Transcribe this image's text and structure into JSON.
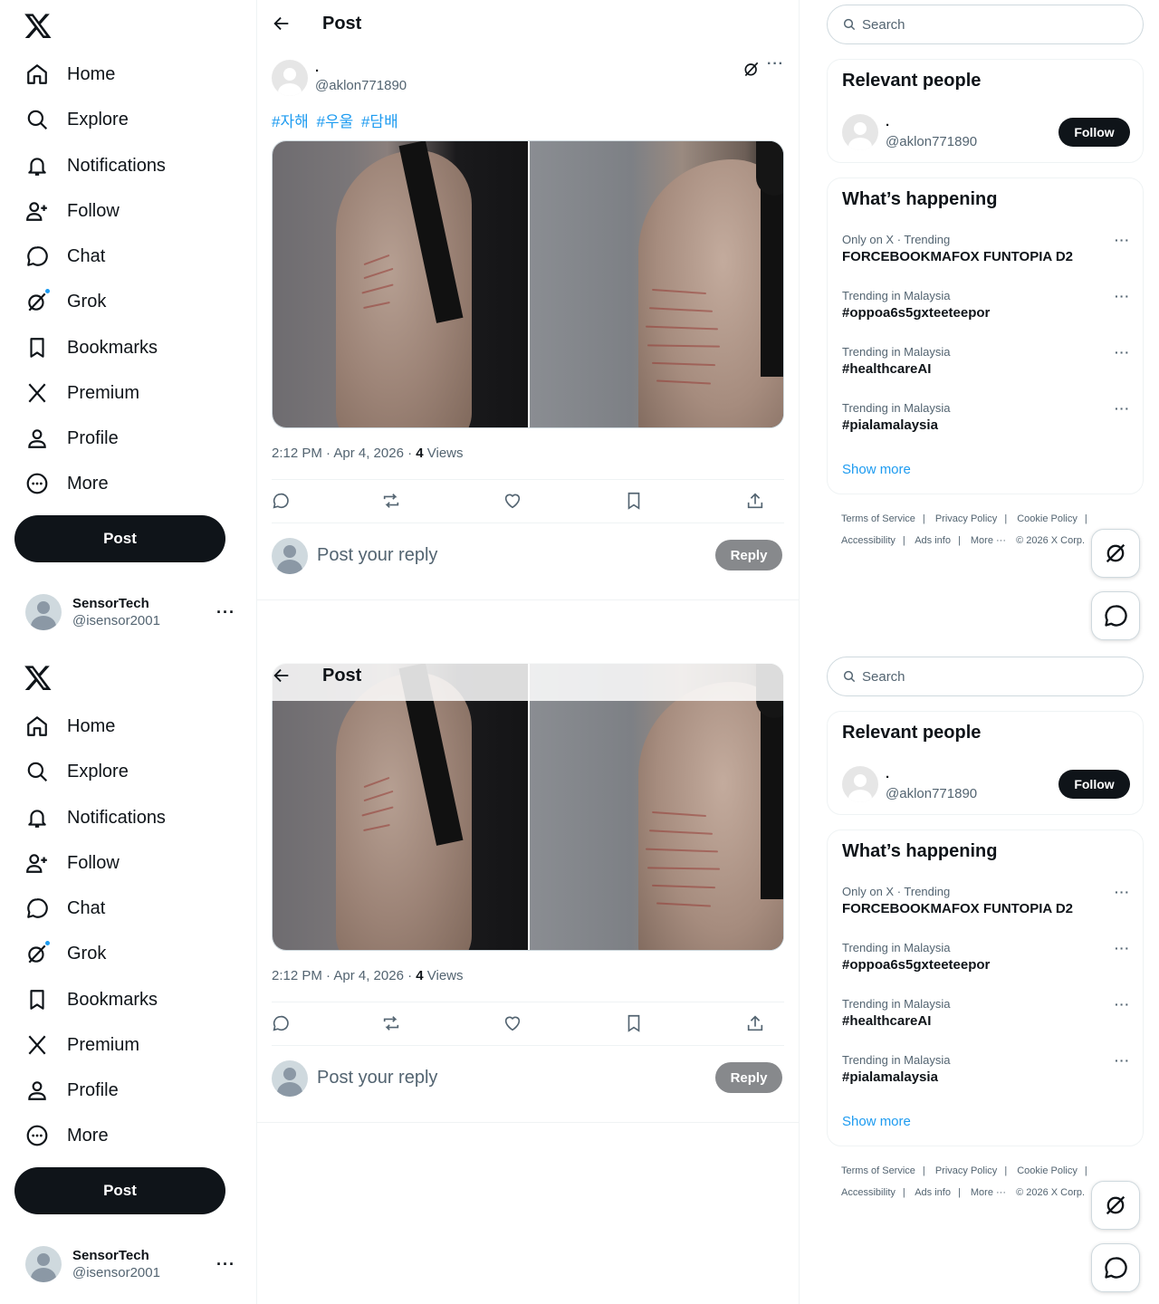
{
  "nav": {
    "items": [
      {
        "label": "Home",
        "icon": "home-icon"
      },
      {
        "label": "Explore",
        "icon": "search-icon"
      },
      {
        "label": "Notifications",
        "icon": "bell-icon"
      },
      {
        "label": "Follow",
        "icon": "person-add-icon"
      },
      {
        "label": "Chat",
        "icon": "chat-bubble-icon"
      },
      {
        "label": "Grok",
        "icon": "grok-icon"
      },
      {
        "label": "Bookmarks",
        "icon": "bookmark-icon"
      },
      {
        "label": "Premium",
        "icon": "x-logo-icon"
      },
      {
        "label": "Profile",
        "icon": "person-icon"
      },
      {
        "label": "More",
        "icon": "more-circle-icon"
      }
    ],
    "post_label": "Post"
  },
  "account": {
    "display_name": "SensorTech",
    "handle": "@isensor2001",
    "more": "···"
  },
  "header": {
    "title": "Post"
  },
  "tweet": {
    "author_name": ".",
    "author_handle": "@aklon771890",
    "more": "···",
    "hashtags": [
      "#자해",
      "#우울",
      "#담배"
    ],
    "time": "2:12 PM · Apr 4, 2026 · ",
    "views_count": "4",
    "views_label": " Views"
  },
  "reply": {
    "placeholder": "Post your reply",
    "button": "Reply"
  },
  "search": {
    "placeholder": "Search"
  },
  "relevant_people": {
    "title": "Relevant people",
    "name": ".",
    "handle": "@aklon771890",
    "follow": "Follow"
  },
  "happening": {
    "title": "What’s happening",
    "trends": [
      {
        "context": "Only on X · Trending",
        "topic": "FORCEBOOKMAFOX FUNTOPIA D2"
      },
      {
        "context": "Trending in Malaysia",
        "topic": "#oppoa6s5gxteeteepor"
      },
      {
        "context": "Trending in Malaysia",
        "topic": "#healthcareAI"
      },
      {
        "context": "Trending in Malaysia",
        "topic": "#pialamalaysia"
      }
    ],
    "trend_more": "···",
    "show_more": "Show more"
  },
  "footer": {
    "links": [
      "Terms of Service",
      "|",
      "Privacy Policy",
      "|",
      "Cookie Policy",
      "|",
      "Accessibility",
      "|",
      "Ads info",
      "|",
      "More ···",
      "© 2026 X Corp."
    ]
  },
  "colors": {
    "accent": "#1d9bf0",
    "text": "#0f1419",
    "muted": "#536471",
    "reply_disabled": "#87898c"
  }
}
